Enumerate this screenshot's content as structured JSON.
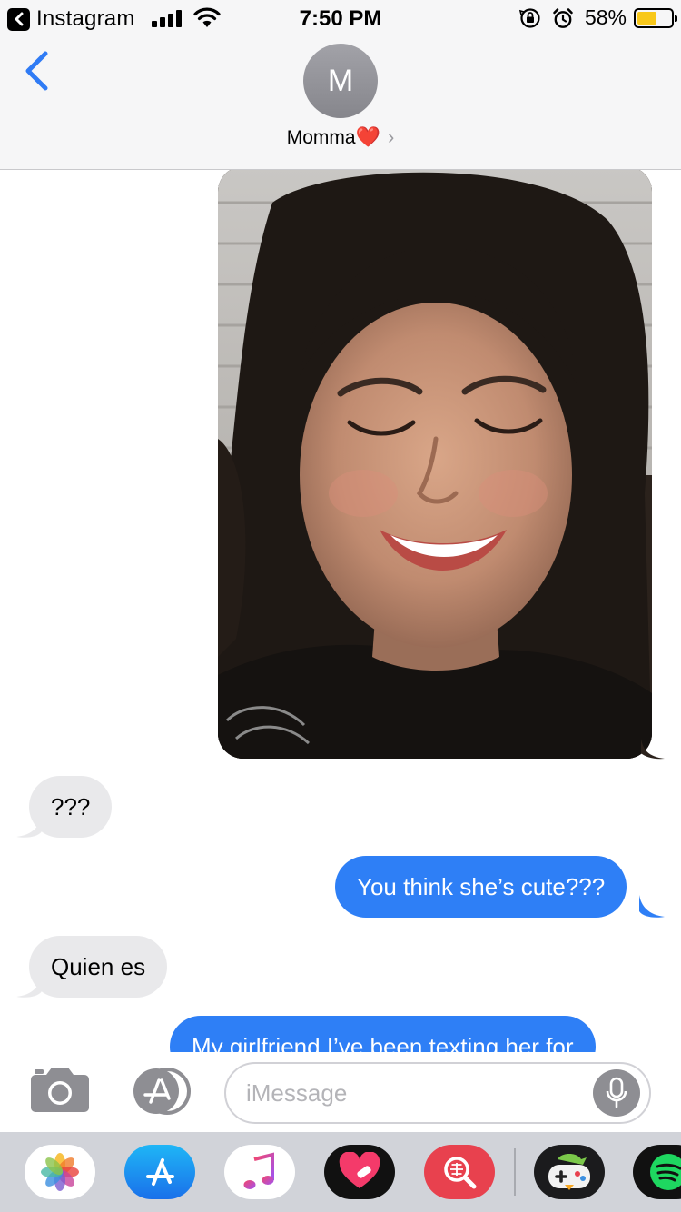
{
  "status_bar": {
    "back_app_label": "Instagram",
    "time": "7:50 PM",
    "battery_percent": "58%",
    "battery_level": 0.58,
    "battery_color": "#f8c81a",
    "icons": [
      "signal-icon",
      "wifi-icon",
      "orientation-lock-icon",
      "alarm-icon",
      "battery-icon"
    ]
  },
  "header": {
    "avatar_initial": "M",
    "contact_name": "Momma",
    "contact_emoji": "❤️",
    "chevron": "›"
  },
  "conversation": {
    "photo_message": {
      "direction": "outgoing",
      "caption": ""
    },
    "messages": [
      {
        "direction": "incoming",
        "text": "???"
      },
      {
        "direction": "outgoing",
        "text": "You think she’s cute???"
      },
      {
        "direction": "incoming",
        "text": "Quien es"
      },
      {
        "direction": "outgoing",
        "text": "My girlfriend I’ve been texting her for"
      }
    ]
  },
  "input_bar": {
    "placeholder": "iMessage",
    "value": ""
  },
  "app_drawer": {
    "apps": [
      "photos-app-icon",
      "app-store-icon",
      "music-app-icon",
      "digital-touch-icon",
      "search-images-icon",
      "game-app-icon",
      "spotify-icon"
    ]
  },
  "colors": {
    "outgoing_bubble": "#2e7ff6",
    "incoming_bubble": "#e9e9eb",
    "accent_blue": "#2f7bf5"
  }
}
